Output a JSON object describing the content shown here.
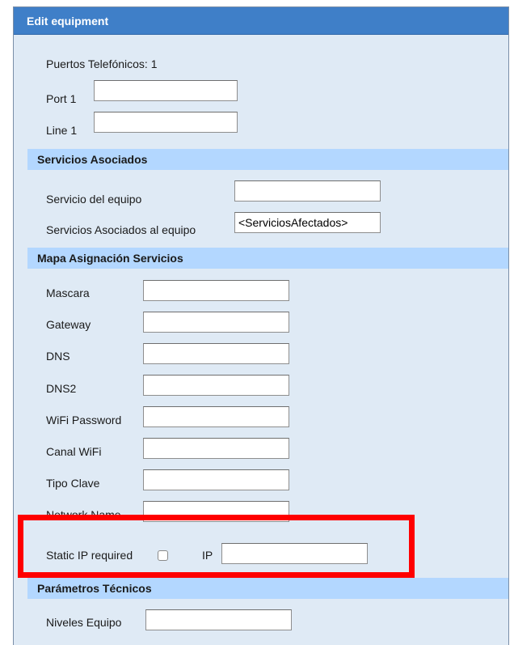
{
  "window": {
    "title": "Edit equipment"
  },
  "phone_ports": {
    "summary": "Puertos Telefónicos: 1"
  },
  "port_fields": [
    {
      "label": "Port 1",
      "value": ""
    },
    {
      "label": "Line 1",
      "value": ""
    }
  ],
  "sections": {
    "servicios_asociados": "Servicios Asociados",
    "mapa_asignacion": "Mapa Asignación Servicios",
    "parametros_tecnicos": "Parámetros Técnicos"
  },
  "servicios_fields": [
    {
      "label": "Servicio del equipo",
      "value": ""
    },
    {
      "label": "Servicios Asociados al equipo",
      "value": "<ServiciosAfectados>"
    }
  ],
  "mapa_fields": [
    {
      "label": "Mascara",
      "value": ""
    },
    {
      "label": "Gateway",
      "value": ""
    },
    {
      "label": "DNS",
      "value": ""
    },
    {
      "label": "DNS2",
      "value": ""
    },
    {
      "label": "WiFi Password",
      "value": ""
    },
    {
      "label": "Canal WiFi",
      "value": ""
    },
    {
      "label": "Tipo Clave",
      "value": ""
    },
    {
      "label": "Network Name",
      "value": ""
    }
  ],
  "static_ip": {
    "label": "Static IP required",
    "checked": false,
    "ip_label": "IP",
    "ip_value": ""
  },
  "tecnicos_fields": [
    {
      "label": "Niveles Equipo",
      "value": ""
    }
  ],
  "colors": {
    "titlebar": "#3f7fc8",
    "panel_background": "#dfeaf5",
    "section_header": "#b3d7ff",
    "highlight": "#ff0000"
  }
}
